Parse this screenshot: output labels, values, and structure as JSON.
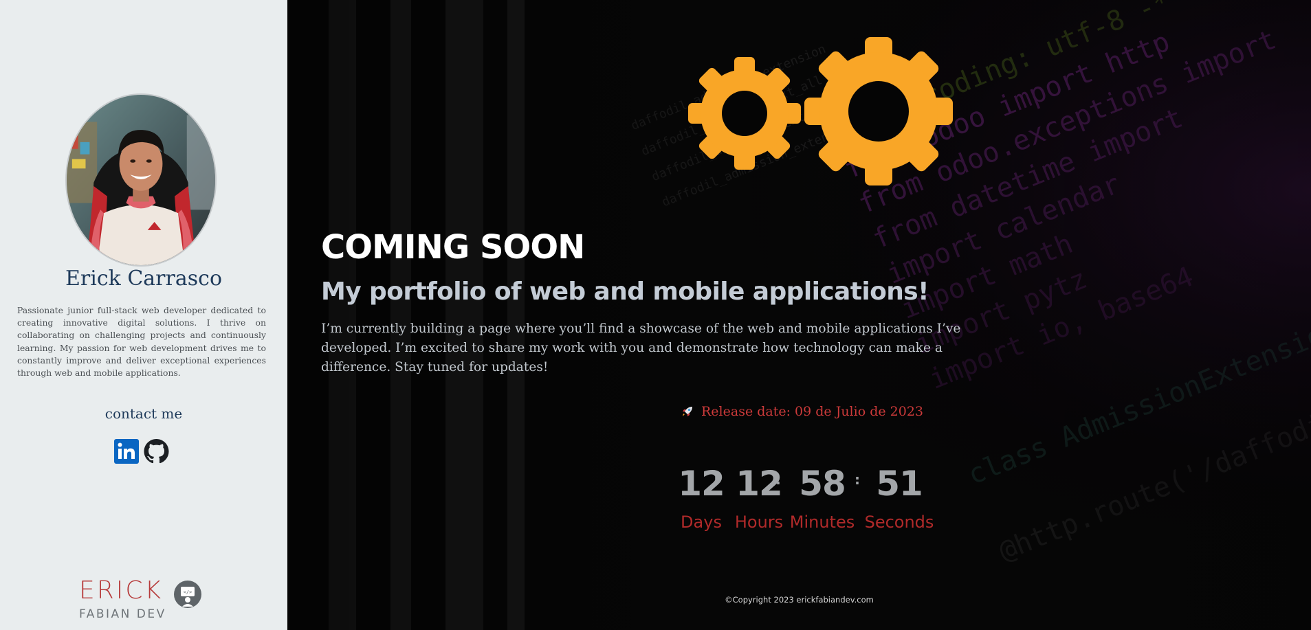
{
  "sidebar": {
    "name": "Erick Carrasco",
    "bio": "Passionate junior full-stack web developer dedicated to creating innovative digital solutions. I thrive on collaborating on challenging projects and continuously learning. My passion for web development drives me to constantly improve and deliver exceptional experiences through web and mobile applications.",
    "contact_title": "contact me",
    "social": [
      {
        "name": "LinkedIn",
        "icon": "linkedin-icon",
        "color": "#0a66c2"
      },
      {
        "name": "GitHub",
        "icon": "github-icon",
        "color": "#1b1f23"
      }
    ],
    "brand": {
      "main": "ERICK",
      "sub": "FABIAN DEV",
      "badge_text": "</>"
    }
  },
  "main": {
    "heading": "COMING SOON",
    "subtitle": "My portfolio of web and mobile applications!",
    "description": "I’m currently building a page where you’ll find a showcase of the web and mobile applications I’ve developed. I’m excited to share my work with you and demonstrate how technology can make a difference. Stay tuned for updates!",
    "release_icon": "rocket-icon",
    "release_text": "Release date: 09 de Julio de 2023",
    "countdown": {
      "days": "12",
      "hours": "12",
      "minutes": "58",
      "seconds": "51",
      "separator": ":",
      "labels": {
        "days": "Days",
        "hours": "Hours",
        "minutes": "Minutes",
        "seconds": "Seconds"
      }
    },
    "copyright": "©Copyright 2023 erickfabiandev.com"
  },
  "colors": {
    "sidebar_bg": "#e9edee",
    "accent_red": "#cc3a3a",
    "gear_orange": "#f9a627",
    "name_blue": "#1e3a5a"
  }
}
